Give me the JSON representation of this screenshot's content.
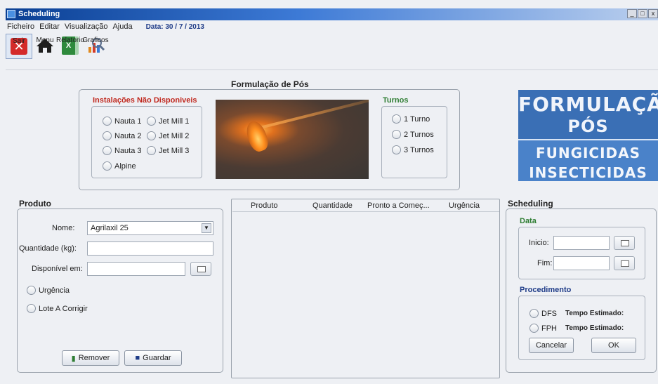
{
  "window": {
    "title": "Scheduling",
    "controls": [
      "_",
      "□",
      "x"
    ]
  },
  "menubar": {
    "items": [
      "Ficheiro",
      "Editar",
      "Visualização",
      "Ajuda"
    ],
    "date": "Data: 30 / 7 / 2013"
  },
  "toolbar": {
    "items": [
      {
        "label": "Sair",
        "icon": "exit-icon"
      },
      {
        "label": "Menu",
        "icon": "home-icon"
      },
      {
        "label": "Relatorio",
        "icon": "excel-icon"
      },
      {
        "label": "Graficos",
        "icon": "chart-search-icon"
      }
    ]
  },
  "formulacao": {
    "title": "Formulação de Pós",
    "instalacoes": {
      "title": "Instalações Não Disponiveis",
      "options": [
        "Nauta 1",
        "Jet Mill 1",
        "Nauta 2",
        "Jet Mill 2",
        "Nauta 3",
        "Jet Mill 3",
        "Alpine"
      ]
    },
    "turnos": {
      "title": "Turnos",
      "options": [
        "1 Turno",
        "2 Turnos",
        "3 Turnos"
      ]
    }
  },
  "banner": {
    "line1": "FORMULAÇÃO",
    "line2": "PÓS",
    "line3": "FUNGICIDAS",
    "line4": "INSECTICIDAS"
  },
  "produto": {
    "title": "Produto",
    "nome_label": "Nome:",
    "nome_value": "Agrilaxil 25",
    "quantidade_label": "Quantidade (kg):",
    "quantidade_value": "",
    "disponivel_label": "Disponível em:",
    "disponivel_value": "",
    "urgencia_label": "Urgência",
    "lote_label": "Lote A Corrigir",
    "remover_label": "Remover",
    "guardar_label": "Guardar"
  },
  "table": {
    "columns": [
      "Produto",
      "Quantidade",
      "Pronto a Começ...",
      "Urgência"
    ],
    "rows": []
  },
  "scheduling": {
    "title": "Scheduling",
    "data_title": "Data",
    "inicio_label": "Inicio:",
    "inicio_value": "",
    "fim_label": "Fim:",
    "fim_value": "",
    "procedimento_title": "Procedimento",
    "dfs_label": "DFS",
    "fph_label": "FPH",
    "tempo_label": "Tempo Estimado:",
    "cancelar_label": "Cancelar",
    "ok_label": "OK"
  }
}
